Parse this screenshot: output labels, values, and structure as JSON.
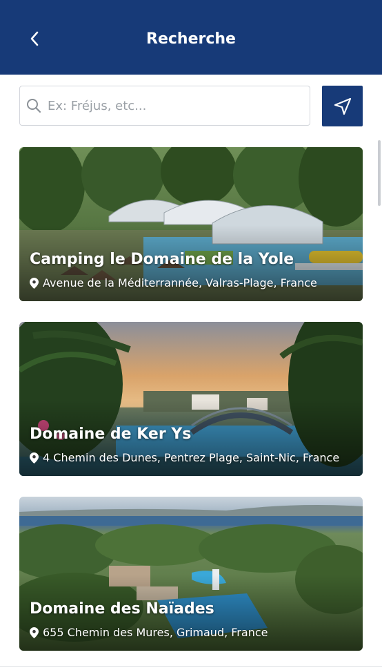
{
  "header": {
    "title": "Recherche",
    "background": "#173a78",
    "back_icon": "chevron-left-icon"
  },
  "search": {
    "placeholder": "Ex: Fréjus, etc...",
    "value": "",
    "icon": "search-icon"
  },
  "locate_button": {
    "icon": "navigation-arrow-icon",
    "background": "#173a78"
  },
  "results": [
    {
      "name": "Camping le Domaine de la Yole",
      "address": "Avenue de la Méditerrannée, Valras-Plage, France",
      "image_theme": "pool-with-covered-domes"
    },
    {
      "name": "Domaine de Ker Ys",
      "address": "4 Chemin des Dunes, Pentrez Plage, Saint-Nic, France",
      "image_theme": "pool-at-sunset-with-palms"
    },
    {
      "name": "Domaine des Naïades",
      "address": "655 Chemin des Mures, Grimaud, France",
      "image_theme": "aerial-view-pool-and-bay"
    }
  ]
}
